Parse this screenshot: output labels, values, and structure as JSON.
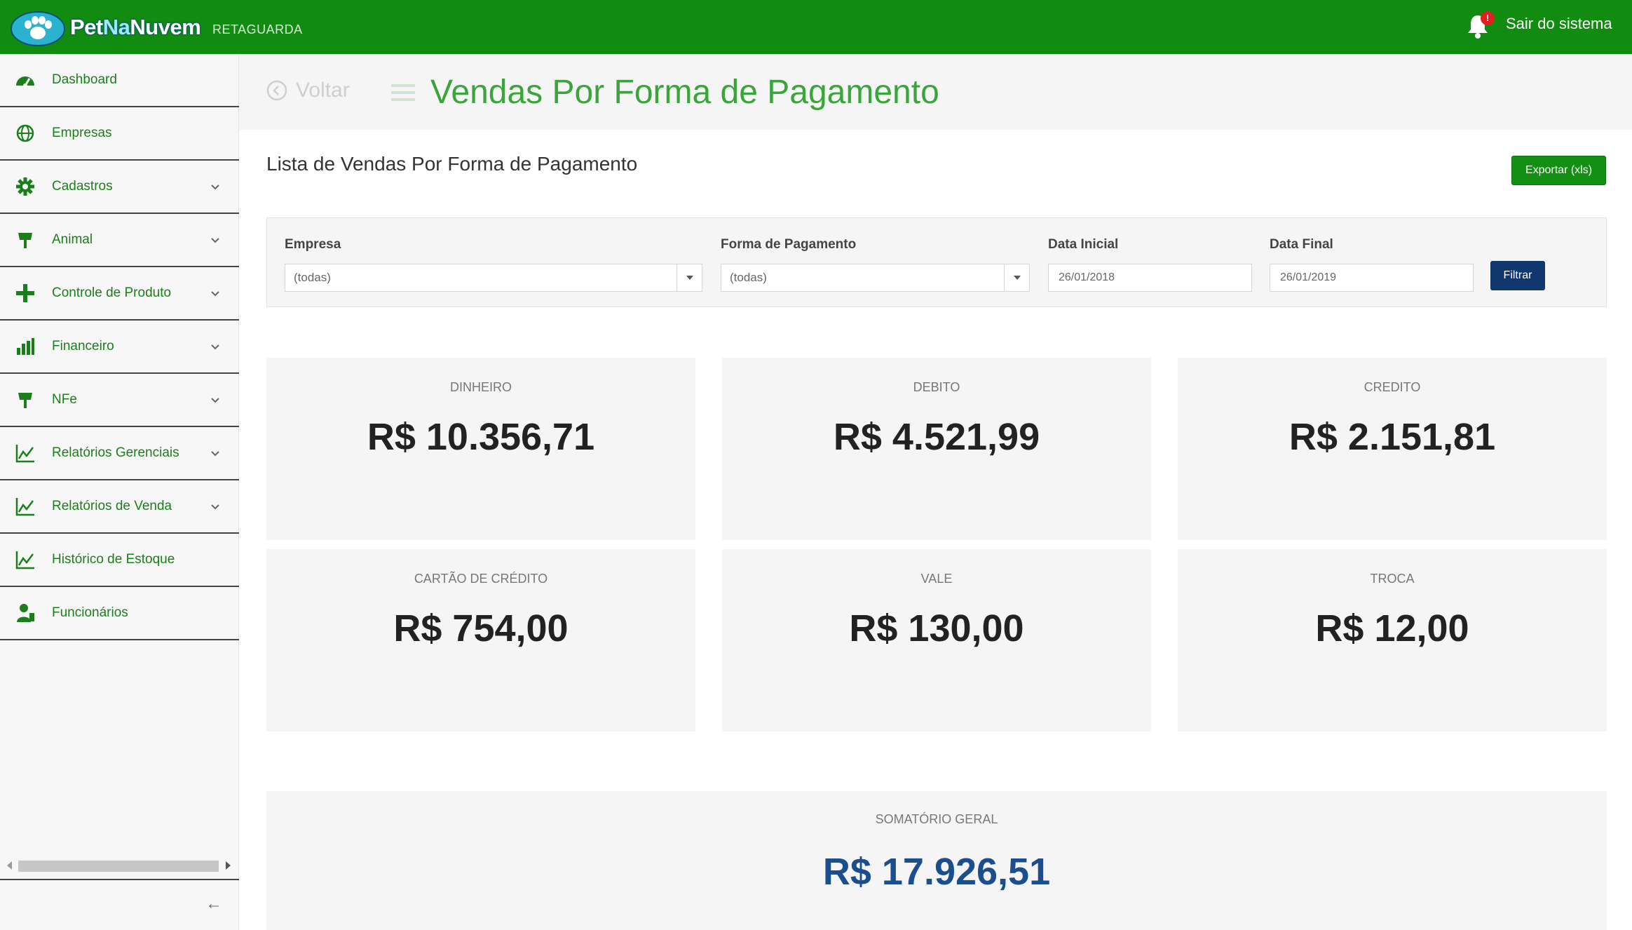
{
  "app": {
    "logo_prefix": "Pet",
    "logo_na": "Na",
    "logo_suffix": "Nuvem",
    "subtitle": "RETAGUARDA",
    "notification_count": "!",
    "logout_label": "Sair do sistema"
  },
  "sidebar": {
    "items": [
      {
        "label": "Dashboard",
        "icon": "dashboard-icon",
        "has_submenu": false
      },
      {
        "label": "Empresas",
        "icon": "globe-icon",
        "has_submenu": false
      },
      {
        "label": "Cadastros",
        "icon": "gear-icon",
        "has_submenu": true
      },
      {
        "label": "Animal",
        "icon": "paw-icon",
        "has_submenu": true
      },
      {
        "label": "Controle de Produto",
        "icon": "plus-icon",
        "has_submenu": true
      },
      {
        "label": "Financeiro",
        "icon": "bar-chart-icon",
        "has_submenu": true
      },
      {
        "label": "NFe",
        "icon": "paw-icon",
        "has_submenu": true
      },
      {
        "label": "Relatórios Gerenciais",
        "icon": "line-chart-icon",
        "has_submenu": true
      },
      {
        "label": "Relatórios de Venda",
        "icon": "line-chart-icon",
        "has_submenu": true
      },
      {
        "label": "Histórico de Estoque",
        "icon": "line-chart-icon",
        "has_submenu": false
      },
      {
        "label": "Funcionários",
        "icon": "user-icon",
        "has_submenu": false
      }
    ],
    "collapse_glyph": "←"
  },
  "header": {
    "back_label": "Voltar",
    "title": "Vendas Por Forma de Pagamento"
  },
  "main": {
    "list_title": "Lista de Vendas Por Forma de Pagamento",
    "export_label": "Exportar (xls)",
    "filters": {
      "empresa_label": "Empresa",
      "empresa_value": "(todas)",
      "forma_label": "Forma de Pagamento",
      "forma_value": "(todas)",
      "data_inicial_label": "Data Inicial",
      "data_inicial_value": "26/01/2018",
      "data_final_label": "Data Final",
      "data_final_value": "26/01/2019",
      "filter_button": "Filtrar"
    },
    "cards": [
      {
        "label": "DINHEIRO",
        "value": "R$ 10.356,71"
      },
      {
        "label": "DEBITO",
        "value": "R$ 4.521,99"
      },
      {
        "label": "CREDITO",
        "value": "R$ 2.151,81"
      },
      {
        "label": "CARTÃO DE CRÉDITO",
        "value": "R$ 754,00"
      },
      {
        "label": "VALE",
        "value": "R$ 130,00"
      },
      {
        "label": "TROCA",
        "value": "R$ 12,00"
      }
    ],
    "total": {
      "label": "SOMATÓRIO GERAL",
      "value": "R$ 17.926,51"
    }
  },
  "colors": {
    "topbar": "#118c11",
    "accent_green": "#1a7f1a",
    "title_green": "#3aa53a",
    "filter_button": "#10386e",
    "total_value": "#1a4e8c"
  }
}
